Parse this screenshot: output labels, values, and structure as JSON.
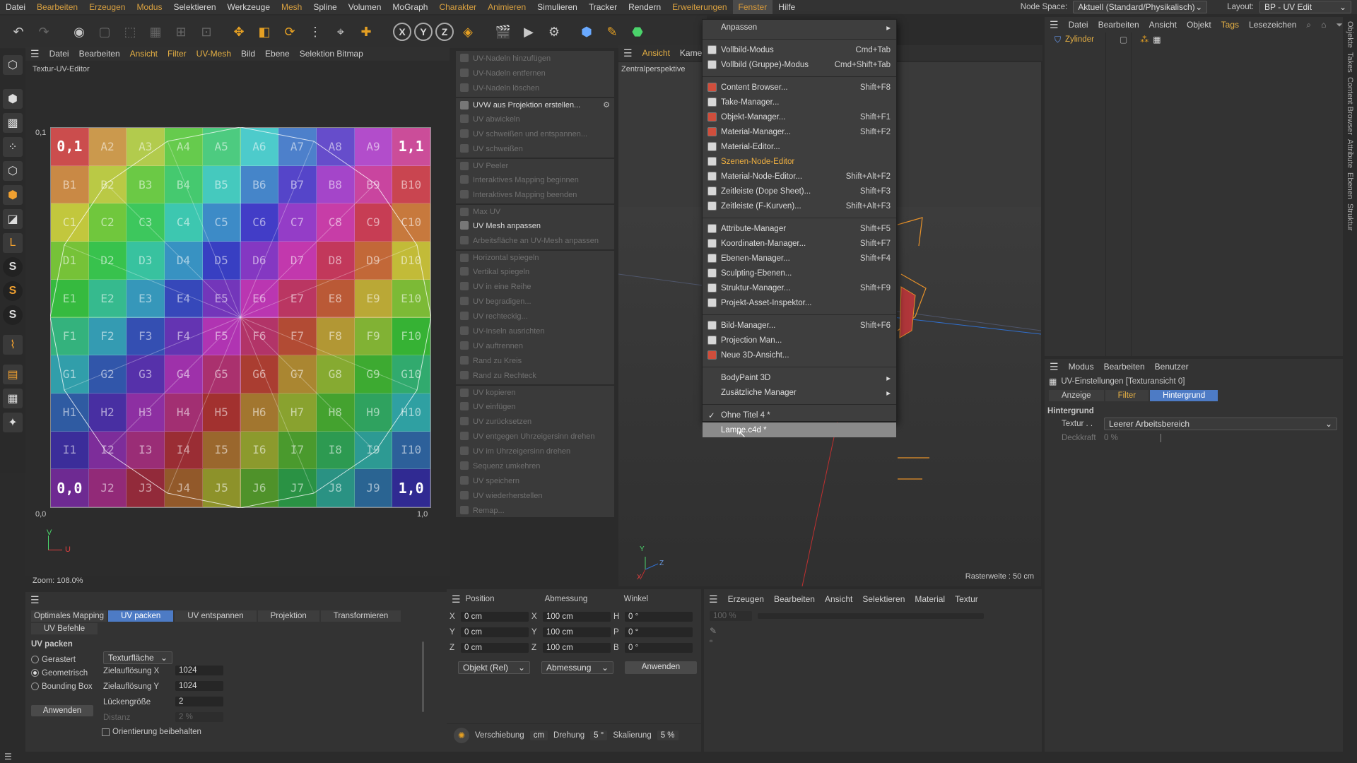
{
  "menubar": {
    "items": [
      "Datei",
      "Bearbeiten",
      "Erzeugen",
      "Modus",
      "Selektieren",
      "Werkzeuge",
      "Mesh",
      "Spline",
      "Volumen",
      "MoGraph",
      "Charakter",
      "Animieren",
      "Simulieren",
      "Tracker",
      "Rendern",
      "Erweiterungen",
      "Fenster",
      "Hilfe"
    ],
    "node_space_label": "Node Space:",
    "node_space_value": "Aktuell (Standard/Physikalisch)",
    "layout_label": "Layout:",
    "layout_value": "BP - UV Edit"
  },
  "uv_editor": {
    "menu": [
      "Datei",
      "Bearbeiten",
      "Ansicht",
      "Filter",
      "UV-Mesh",
      "Bild",
      "Ebene",
      "Selektion Bitmap"
    ],
    "title": "Textur-UV-Editor",
    "zoom": "Zoom: 108.0%",
    "label_tl": "0,1",
    "label_bl": "0,0",
    "label_br": "1,0",
    "label_tr": "1,1",
    "axis_v": "V",
    "axis_u": "U",
    "rows": [
      "A",
      "B",
      "C",
      "D",
      "E",
      "F",
      "G",
      "H",
      "I",
      "J"
    ]
  },
  "commands": [
    {
      "label": "UV-Nadeln hinzufügen",
      "on": false
    },
    {
      "label": "UV-Nadeln entfernen",
      "on": false
    },
    {
      "label": "UV-Nadeln löschen",
      "on": false
    },
    {
      "label": "UVW aus Projektion erstellen...",
      "on": true,
      "sep": true
    },
    {
      "label": "UV abwickeln",
      "on": false
    },
    {
      "label": "UV schweißen und entspannen...",
      "on": false
    },
    {
      "label": "UV schweißen",
      "on": false
    },
    {
      "label": "UV Peeler",
      "on": false,
      "sep": true
    },
    {
      "label": "Interaktives Mapping beginnen",
      "on": false
    },
    {
      "label": "Interaktives Mapping beenden",
      "on": false
    },
    {
      "label": "Max UV",
      "on": false,
      "sep": true
    },
    {
      "label": "UV Mesh anpassen",
      "on": true
    },
    {
      "label": "Arbeitsfläche an UV-Mesh anpassen",
      "on": false
    },
    {
      "label": "Horizontal spiegeln",
      "on": false,
      "sep": true
    },
    {
      "label": "Vertikal spiegeln",
      "on": false
    },
    {
      "label": "UV in eine Reihe",
      "on": false
    },
    {
      "label": "UV begradigen...",
      "on": false
    },
    {
      "label": "UV rechteckig...",
      "on": false
    },
    {
      "label": "UV-Inseln ausrichten",
      "on": false
    },
    {
      "label": "UV auftrennen",
      "on": false
    },
    {
      "label": "Rand zu Kreis",
      "on": false
    },
    {
      "label": "Rand zu Rechteck",
      "on": false
    },
    {
      "label": "UV kopieren",
      "on": false,
      "sep": true
    },
    {
      "label": "UV einfügen",
      "on": false
    },
    {
      "label": "UV zurücksetzen",
      "on": false
    },
    {
      "label": "UV entgegen Uhrzeigersinn drehen",
      "on": false
    },
    {
      "label": "UV im Uhrzeigersinn drehen",
      "on": false
    },
    {
      "label": "Sequenz umkehren",
      "on": false
    },
    {
      "label": "UV speichern",
      "on": false
    },
    {
      "label": "UV wiederherstellen",
      "on": false
    },
    {
      "label": "Remap...",
      "on": false
    }
  ],
  "viewport": {
    "menu": [
      "Ansicht",
      "Kamera"
    ],
    "label": "Zentralperspektive",
    "grid_size": "Rasterweite : 50 cm",
    "axis_y": "Y",
    "axis_z": "Z",
    "axis_x": "X"
  },
  "fenster_menu": {
    "items": [
      {
        "label": "Anpassen",
        "shortcut": "",
        "sub": true,
        "icon": "none"
      },
      {
        "sep": true
      },
      {
        "label": "Vollbild-Modus",
        "shortcut": "Cmd+Tab",
        "icon": "w"
      },
      {
        "label": "Vollbild (Gruppe)-Modus",
        "shortcut": "Cmd+Shift+Tab",
        "icon": "w"
      },
      {
        "sep": true
      },
      {
        "label": "Content Browser...",
        "shortcut": "Shift+F8",
        "icon": "r"
      },
      {
        "label": "Take-Manager...",
        "shortcut": "",
        "icon": "w"
      },
      {
        "label": "Objekt-Manager...",
        "shortcut": "Shift+F1",
        "icon": "r"
      },
      {
        "label": "Material-Manager...",
        "shortcut": "Shift+F2",
        "icon": "r"
      },
      {
        "label": "Material-Editor...",
        "shortcut": "",
        "icon": "w"
      },
      {
        "label": "Szenen-Node-Editor",
        "shortcut": "",
        "icon": "w",
        "hl": true
      },
      {
        "label": "Material-Node-Editor...",
        "shortcut": "Shift+Alt+F2",
        "icon": "w"
      },
      {
        "label": "Zeitleiste (Dope Sheet)...",
        "shortcut": "Shift+F3",
        "icon": "w"
      },
      {
        "label": "Zeitleiste (F-Kurven)...",
        "shortcut": "Shift+Alt+F3",
        "icon": "w"
      },
      {
        "sep": true
      },
      {
        "label": "Attribute-Manager",
        "shortcut": "Shift+F5",
        "icon": "w"
      },
      {
        "label": "Koordinaten-Manager...",
        "shortcut": "Shift+F7",
        "icon": "w"
      },
      {
        "label": "Ebenen-Manager...",
        "shortcut": "Shift+F4",
        "icon": "w"
      },
      {
        "label": "Sculpting-Ebenen...",
        "shortcut": "",
        "icon": "w"
      },
      {
        "label": "Struktur-Manager...",
        "shortcut": "Shift+F9",
        "icon": "w"
      },
      {
        "label": "Projekt-Asset-Inspektor...",
        "shortcut": "",
        "icon": "w"
      },
      {
        "sep": true
      },
      {
        "label": "Bild-Manager...",
        "shortcut": "Shift+F6",
        "icon": "w"
      },
      {
        "label": "Projection Man...",
        "shortcut": "",
        "icon": "w"
      },
      {
        "label": "Neue 3D-Ansicht...",
        "shortcut": "",
        "icon": "r"
      },
      {
        "sep": true
      },
      {
        "label": "BodyPaint 3D",
        "shortcut": "",
        "sub": true,
        "icon": "none"
      },
      {
        "label": "Zusätzliche Manager",
        "shortcut": "",
        "sub": true,
        "icon": "none"
      },
      {
        "sep": true
      },
      {
        "label": "Ohne Titel 4 *",
        "shortcut": "",
        "icon": "check"
      },
      {
        "label": "Lampe.c4d *",
        "shortcut": "",
        "icon": "none",
        "hover": true
      }
    ]
  },
  "object_manager": {
    "menu": [
      "Datei",
      "Bearbeiten",
      "Ansicht",
      "Objekt",
      "Tags",
      "Lesezeichen"
    ],
    "object": "Zylinder"
  },
  "attributes": {
    "menu": [
      "Modus",
      "Bearbeiten",
      "Benutzer"
    ],
    "title": "UV-Einstellungen [Texturansicht 0]",
    "tabs": [
      "Anzeige",
      "Filter",
      "Hintergrund"
    ],
    "section": "Hintergrund",
    "textur_label": "Textur . .",
    "textur_value": "Leerer Arbeitsbereich",
    "deckkraft_label": "Deckkraft",
    "deckkraft_value": "0 %"
  },
  "right_strip": [
    "Objekte",
    "Takes",
    "Content Browser",
    "Attribute",
    "Ebenen",
    "Struktur"
  ],
  "uv_tools": {
    "tabs": [
      "Optimales Mapping",
      "UV packen",
      "UV entspannen",
      "Projektion",
      "Transformieren",
      "UV Befehle"
    ],
    "section": "UV packen",
    "radios": [
      "Gerastert",
      "Geometrisch",
      "Bounding Box"
    ],
    "mode_value": "Texturfläche",
    "zielx_label": "Zielauflösung X",
    "zielx_value": "1024",
    "ziely_label": "Zielauflösung Y",
    "ziely_value": "1024",
    "gap_label": "Lückengröße",
    "gap_value": "2",
    "distance_label": "Distanz",
    "distance_value": "2 %",
    "keep_orient": "Orientierung beibehalten",
    "apply": "Anwenden"
  },
  "coordinates": {
    "headers": [
      "Position",
      "Abmessung",
      "Winkel"
    ],
    "rows": [
      {
        "axis": "X",
        "pos": "0 cm",
        "saxis": "X",
        "size": "100 cm",
        "raxis": "H",
        "rot": "0 °"
      },
      {
        "axis": "Y",
        "pos": "0 cm",
        "saxis": "Y",
        "size": "100 cm",
        "raxis": "P",
        "rot": "0 °"
      },
      {
        "axis": "Z",
        "pos": "0 cm",
        "saxis": "Z",
        "size": "100 cm",
        "raxis": "B",
        "rot": "0 °"
      }
    ],
    "mode": "Objekt (Rel)",
    "size_mode": "Abmessung",
    "apply": "Anwenden",
    "shift_label": "Verschiebung",
    "shift_unit": "cm",
    "rot_label": "Drehung",
    "rot_value": "5 °",
    "scale_label": "Skalierung",
    "scale_value": "5 %"
  },
  "material_manager": {
    "menu": [
      "Erzeugen",
      "Bearbeiten",
      "Ansicht",
      "Selektieren",
      "Material",
      "Textur"
    ],
    "zoom": "100 %"
  }
}
